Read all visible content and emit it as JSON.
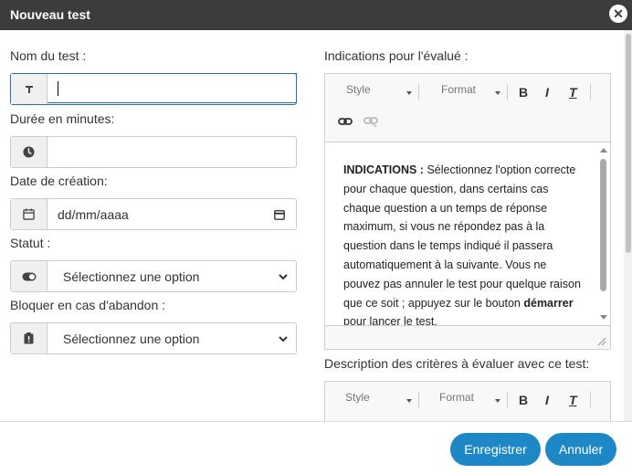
{
  "dialog": {
    "title": "Nouveau test",
    "close_glyph": "✕"
  },
  "form": {
    "name_label": "Nom du test :",
    "name_value": "",
    "duration_label": "Durée en minutes:",
    "duration_value": "",
    "date_label": "Date de création:",
    "date_placeholder": "dd/mm/aaaa",
    "status_label": "Statut :",
    "status_value": "Sélectionnez une option",
    "block_label": "Bloquer en cas d'abandon :",
    "block_value": "Sélectionnez une option"
  },
  "instructions_editor": {
    "label": "Indications pour l'évalué :",
    "style_combo": "Style",
    "format_combo": "Format",
    "bold_glyph": "B",
    "italic_glyph": "I",
    "clear_format_glyph": "T",
    "content_bold_lead": "INDICATIONS :",
    "content_text_1": " Sélectionnez l'option correcte pour chaque question, dans certains cas chaque question a un temps de réponse maximum, si vous ne répondez pas à la question dans le temps indiqué il passera automatiquement à la suivante. Vous ne pouvez pas annuler le test pour quelque raison que ce soit ; appuyez sur le bouton ",
    "content_bold_word": "démarrer",
    "content_text_2": " pour lancer le test."
  },
  "criteria_editor": {
    "label": "Description des critères à évaluer avec ce test:",
    "style_combo": "Style",
    "format_combo": "Format",
    "bold_glyph": "B",
    "italic_glyph": "I",
    "clear_format_glyph": "T"
  },
  "footer": {
    "save_label": "Enregistrer",
    "cancel_label": "Annuler"
  },
  "colors": {
    "titlebar": "#3c3c3c",
    "primary_button": "#1e88c7",
    "focus_border": "#2d6fa3"
  },
  "icons": {
    "name_addon": "text-t-icon",
    "duration_addon": "clock-icon",
    "date_addon": "calendar-icon",
    "status_addon": "toggle-icon",
    "block_addon": "clipboard-alert-icon"
  }
}
